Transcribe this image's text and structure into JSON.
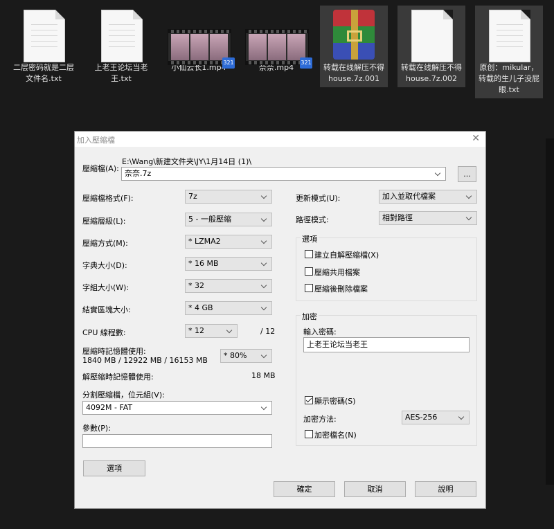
{
  "files": [
    {
      "name": "二层密码就是二层文件名.txt",
      "type": "txt"
    },
    {
      "name": "上老王论坛当老王.txt",
      "type": "txt"
    },
    {
      "name": "小仙云长1.mp4",
      "type": "video"
    },
    {
      "name": "奈奈.mp4",
      "type": "video"
    },
    {
      "name": "转载在线解压不得house.7z.001",
      "type": "archive"
    },
    {
      "name": "转载在线解压不得house.7z.002",
      "type": "txt"
    },
    {
      "name": "原创：mikular，转载的生儿子没屁眼.txt",
      "type": "txt"
    }
  ],
  "video_badge": "321",
  "dialog": {
    "title": "加入壓縮檔",
    "close_icon": "close-icon",
    "archive_label": "壓縮檔(A):",
    "archive_path": "E:\\Wang\\新建文件夹\\JY\\1月14日 (1)\\",
    "archive_name": "奈奈.7z",
    "browse_label": "...",
    "format_label": "壓縮檔格式(F):",
    "format_value": "7z",
    "level_label": "壓縮層級(L):",
    "level_value": "5 - 一般壓縮",
    "method_label": "壓縮方式(M):",
    "method_value": "* LZMA2",
    "dict_label": "字典大小(D):",
    "dict_value": "* 16 MB",
    "word_label": "字組大小(W):",
    "word_value": "* 32",
    "solid_label": "結實區塊大小:",
    "solid_value": "* 4 GB",
    "cpu_label": "CPU 線程數:",
    "cpu_value": "* 12",
    "cpu_total": "/ 12",
    "mem_label": "壓縮時記憶體使用:",
    "mem_detail": "1840 MB / 12922 MB / 16153 MB",
    "mem_value": "* 80%",
    "decomp_label": "解壓縮時記憶體使用:",
    "decomp_value": "18 MB",
    "split_label": "分割壓縮檔，位元組(V):",
    "split_value": "4092M - FAT",
    "params_label": "參數(P):",
    "params_value": "",
    "options_button": "選項",
    "update_label": "更新模式(U):",
    "update_value": "加入並取代檔案",
    "path_label": "路徑模式:",
    "path_value": "相對路徑",
    "options_group": "選項",
    "opt_sfx": "建立自解壓縮檔(X)",
    "opt_shared": "壓縮共用檔案",
    "opt_delete": "壓縮後刪除檔案",
    "enc_group": "加密",
    "password_label": "輸入密碼:",
    "password_value": "上老王论坛当老王",
    "show_password": "顯示密碼(S)",
    "enc_method_label": "加密方法:",
    "enc_method_value": "AES-256",
    "enc_names": "加密檔名(N)",
    "ok": "確定",
    "cancel": "取消",
    "help": "說明"
  }
}
